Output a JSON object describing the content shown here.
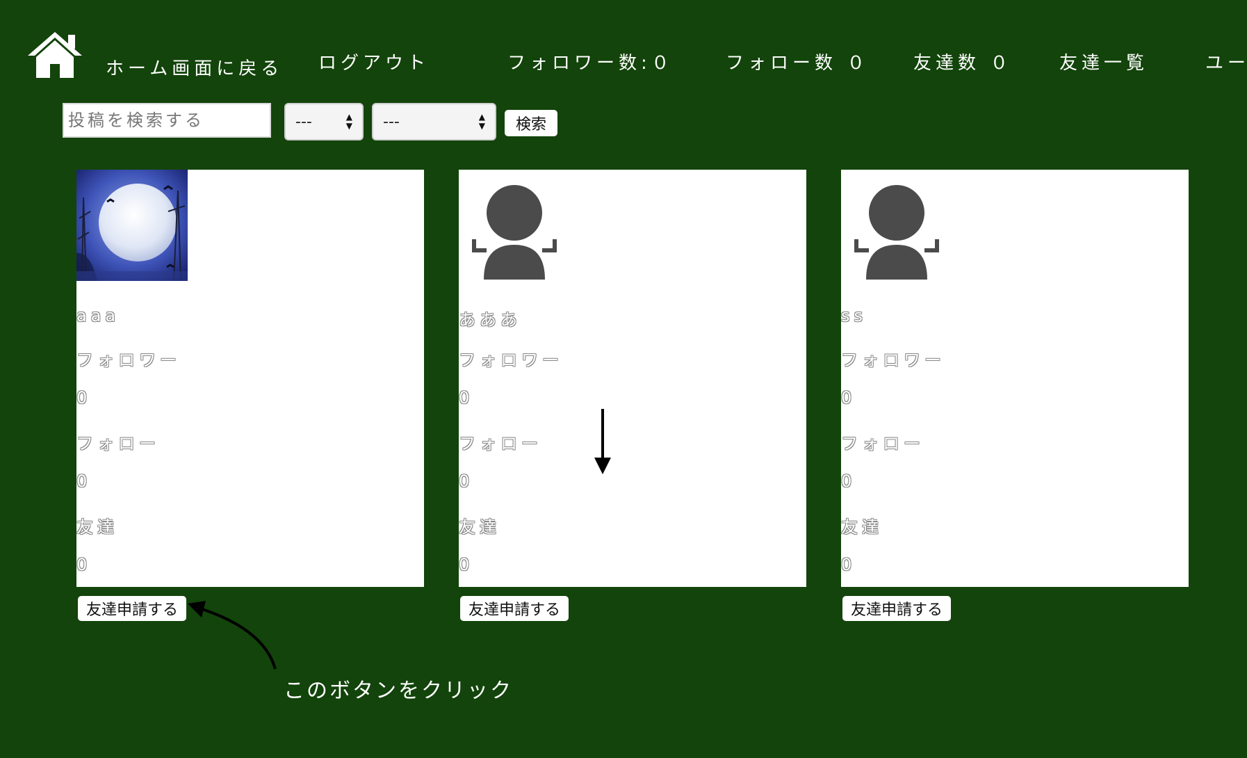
{
  "nav": {
    "home_label": "ホーム画面に戻る",
    "logout_label": "ログアウト",
    "followers_label": "フォロワー数:０",
    "following_label": "フォロー数 ０",
    "friends_count_label": "友達数 ０",
    "friends_list_label": "友達一覧",
    "users_label": "ユー"
  },
  "search": {
    "placeholder": "投稿を検索する",
    "select1_value": "---",
    "select2_value": "---",
    "button_label": "検索"
  },
  "users": [
    {
      "name": "aaa",
      "avatar": "moon-photo",
      "followers_label": "フォロワー",
      "followers_count": "0",
      "following_label": "フォロー",
      "following_count": "0",
      "friends_label": "友達",
      "friends_count": "0",
      "request_button": "友達申請する"
    },
    {
      "name": "あああ",
      "avatar": "default-user-icon",
      "followers_label": "フォロワー",
      "followers_count": "0",
      "following_label": "フォロー",
      "following_count": "0",
      "friends_label": "友達",
      "friends_count": "0",
      "request_button": "友達申請する"
    },
    {
      "name": "ss",
      "avatar": "default-user-icon",
      "followers_label": "フォロワー",
      "followers_count": "0",
      "following_label": "フォロー",
      "following_count": "0",
      "friends_label": "友達",
      "friends_count": "0",
      "request_button": "友達申請する"
    }
  ],
  "annotation": {
    "text": "このボタンをクリック"
  },
  "colors": {
    "background": "#13440b",
    "card": "#ffffff",
    "text": "#ffffff"
  }
}
